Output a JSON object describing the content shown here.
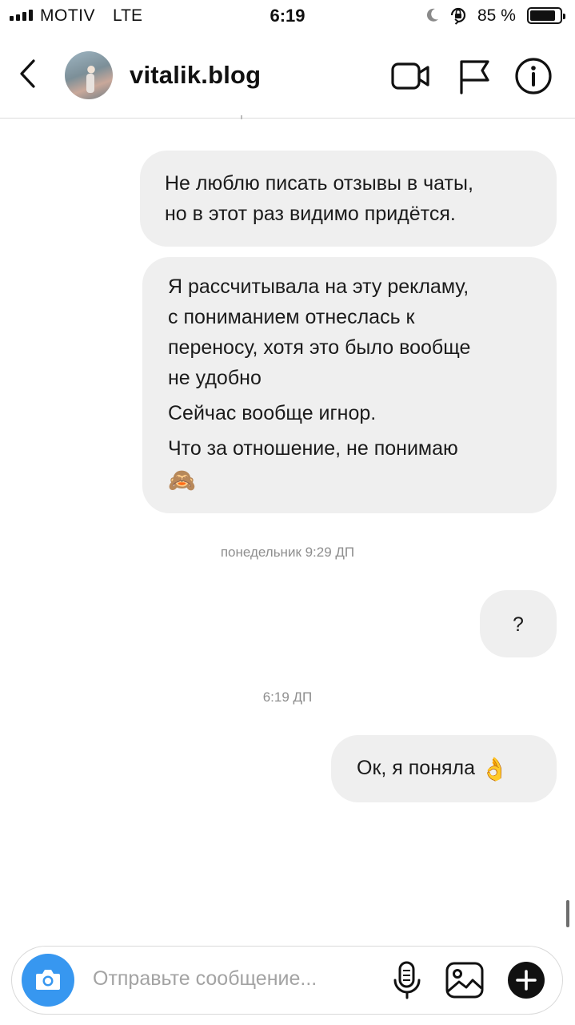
{
  "status_bar": {
    "carrier": "MOTIV",
    "network": "LTE",
    "time": "6:19",
    "battery_percent": "85 %",
    "battery_level": 0.85,
    "icons": [
      "signal-icon",
      "moon-icon",
      "orientation-lock-icon",
      "battery-icon"
    ]
  },
  "header": {
    "username": "vitalik.blog",
    "icons": [
      "back-chevron-icon",
      "avatar",
      "video-call-icon",
      "flag-icon",
      "info-icon"
    ]
  },
  "messages": [
    {
      "lines": [
        "Не люблю писать отзывы в чаты,",
        "но в этот раз видимо придётся."
      ]
    },
    {
      "lines": [
        "Я рассчитывала на эту рекламу,",
        "с пониманием отнеслась к",
        "переносу, хотя это было вообще",
        "не удобно",
        "Сейчас вообще игнор.",
        "Что за отношение, не понимаю"
      ],
      "emoji": "🙈"
    },
    {
      "text": "?"
    },
    {
      "text": "Ок, я поняла",
      "emoji": "👌"
    }
  ],
  "timestamps": [
    "понедельник 9:29 ДП",
    "6:19 ДП"
  ],
  "composer": {
    "placeholder": "Отправьте сообщение...",
    "value": "",
    "icons": [
      "camera-icon",
      "microphone-icon",
      "gallery-icon",
      "add-icon"
    ]
  },
  "colors": {
    "bubble_bg": "#efefef",
    "camera_button": "#3797f0",
    "timestamp_text": "#8e8e8e",
    "placeholder_text": "#a3a3a3"
  }
}
